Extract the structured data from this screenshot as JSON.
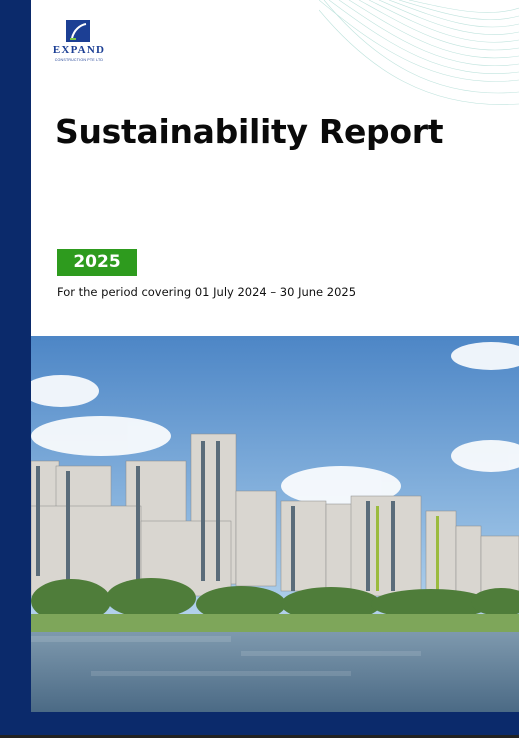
{
  "logo": {
    "brand": "EXPAND",
    "subtitle": "CONSTRUCTION PTE LTD"
  },
  "cover": {
    "title": "Sustainability Report",
    "year": "2025",
    "period": "For the period covering 01 July 2024 – 30 June 2025"
  },
  "colors": {
    "band": "#0b2a6b",
    "accent_green": "#2e9b1e",
    "logo_blue": "#1c3f94"
  },
  "image": {
    "subject": "photo-residential-high-rise-waterfront"
  }
}
